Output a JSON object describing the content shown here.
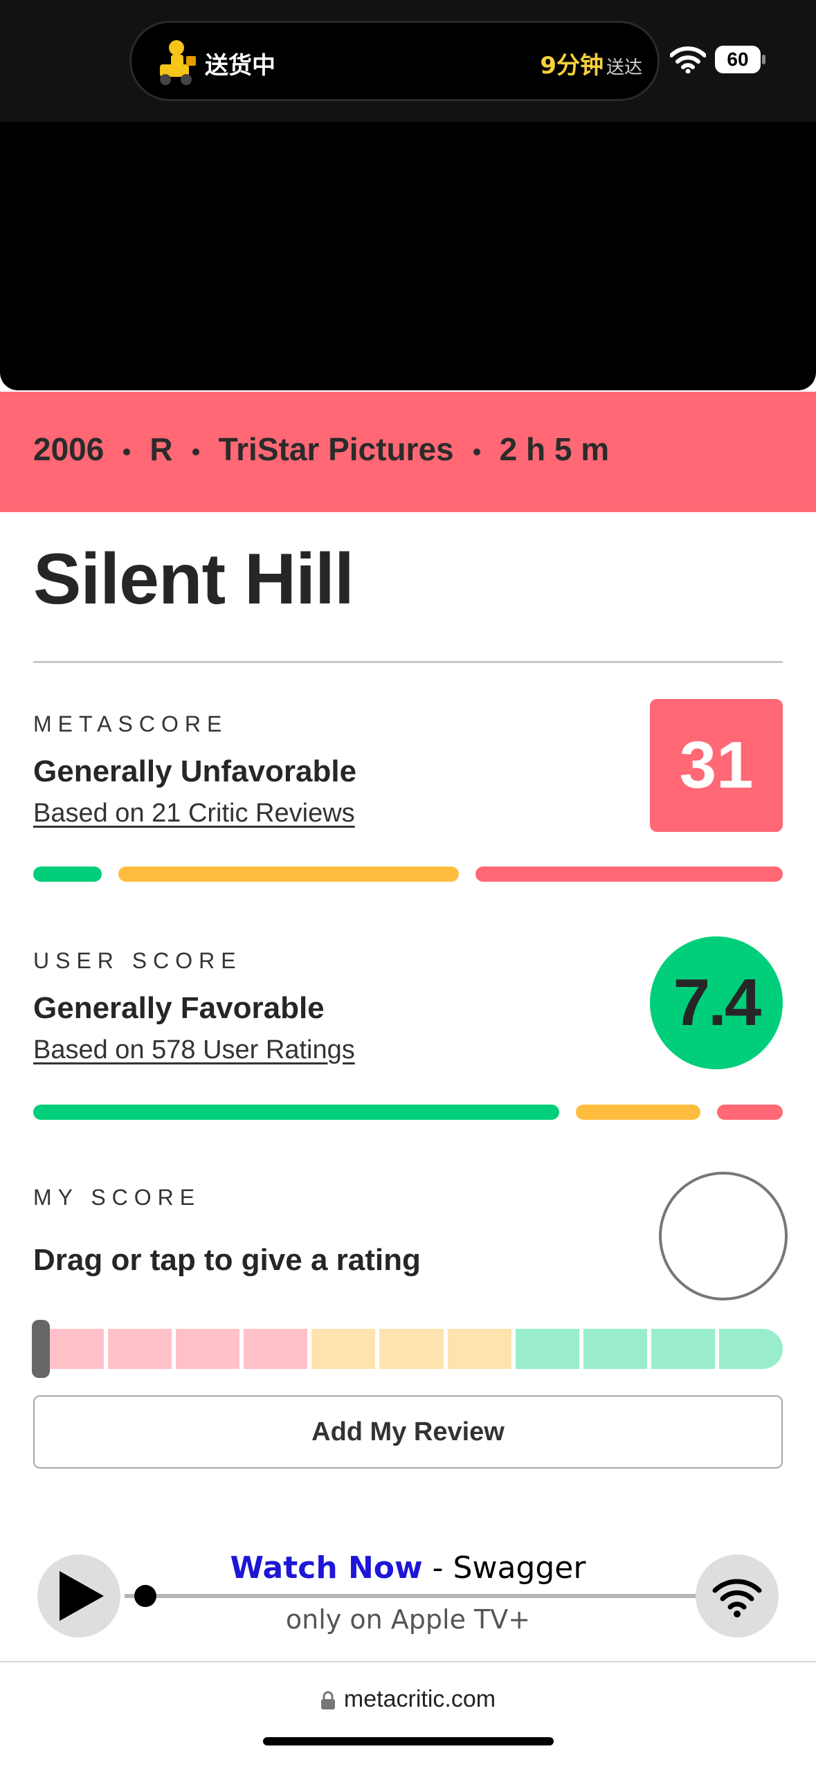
{
  "status_bar": {
    "live_activity_label": "送货中",
    "eta_time": "9分钟",
    "eta_suffix": "送达",
    "battery": "60",
    "icons": [
      "delivery-courier-icon",
      "wifi-icon",
      "battery-icon"
    ]
  },
  "movie": {
    "year": "2006",
    "rating": "R",
    "studio": "TriStar Pictures",
    "runtime": "2 h 5 m",
    "title": "Silent Hill"
  },
  "metascore": {
    "label": "METASCORE",
    "verdict": "Generally Unfavorable",
    "basis": "Based on 21 Critic Reviews",
    "score": "31",
    "distribution": {
      "positive": 2,
      "mixed": 10,
      "negative": 9
    }
  },
  "user_score": {
    "label": "USER SCORE",
    "verdict": "Generally Favorable",
    "basis": "Based on 578 User Ratings",
    "score": "7.4",
    "distribution": {
      "positive": 0.72,
      "mixed": 0.17,
      "negative": 0.09
    }
  },
  "my_score": {
    "label": "MY SCORE",
    "prompt": "Drag or tap to give a rating",
    "value": null,
    "segments": 11
  },
  "add_review_label": "Add My Review",
  "ad": {
    "link_text": "Watch Now",
    "separator": " - ",
    "title": "Swagger",
    "subtitle": "only on Apple TV+"
  },
  "browser": {
    "url": "metacritic.com"
  },
  "colors": {
    "negative": "#ff6874",
    "mixed": "#ffbd3f",
    "positive": "#00ce7a",
    "negative_light": "#ffc1c7",
    "mixed_light": "#ffe3ae",
    "positive_light": "#9aedcb"
  }
}
